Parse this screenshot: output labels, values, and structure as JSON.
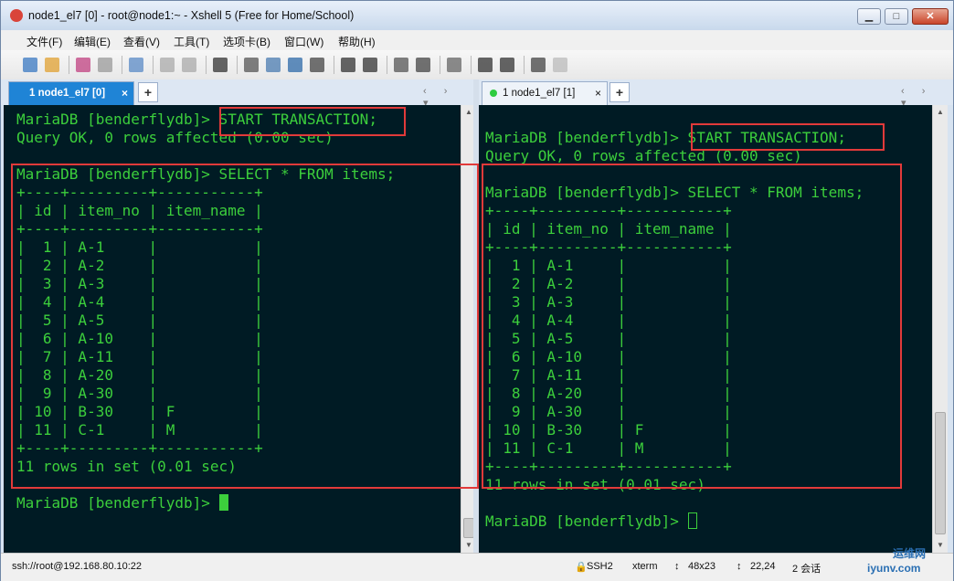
{
  "window": {
    "title": "node1_el7 [0] - root@node1:~ - Xshell 5 (Free for Home/School)",
    "buttons": {
      "minimize": "▁",
      "maximize": "□",
      "close": "✕"
    }
  },
  "menu": [
    "文件(F)",
    "编辑(E)",
    "查看(V)",
    "工具(T)",
    "选项卡(B)",
    "窗口(W)",
    "帮助(H)"
  ],
  "toolbar": {
    "icons": [
      "new-session-icon",
      "open-folder-icon",
      "reconnect-icon",
      "disconnect-icon",
      "properties-icon",
      "copy-icon",
      "paste-icon",
      "find-icon",
      "print-icon",
      "transfer-icon",
      "globe-icon",
      "font-icon",
      "xftp-icon",
      "xmanager-icon",
      "fullscreen-icon",
      "lock-icon",
      "keyboard-icon",
      "add-icon",
      "layout-icon",
      "help-icon",
      "chat-icon"
    ]
  },
  "left_pane": {
    "tab_label": "1 node1_el7 [0]",
    "tab_close": "×",
    "tab_add": "+",
    "lines": [
      "MariaDB [benderflydb]> START TRANSACTION;",
      "Query OK, 0 rows affected (0.00 sec)",
      "",
      "MariaDB [benderflydb]> SELECT * FROM items;",
      "+----+---------+-----------+",
      "| id | item_no | item_name |",
      "+----+---------+-----------+",
      "|  1 | A-1     |           |",
      "|  2 | A-2     |           |",
      "|  3 | A-3     |           |",
      "|  4 | A-4     |           |",
      "|  5 | A-5     |           |",
      "|  6 | A-10    |           |",
      "|  7 | A-11    |           |",
      "|  8 | A-20    |           |",
      "|  9 | A-30    |           |",
      "| 10 | B-30    | F         |",
      "| 11 | C-1     | M         |",
      "+----+---------+-----------+",
      "11 rows in set (0.01 sec)",
      "",
      "MariaDB [benderflydb]> "
    ]
  },
  "right_pane": {
    "tab_label": "1 node1_el7 [1]",
    "tab_close": "×",
    "tab_add": "+",
    "lines": [
      "",
      "MariaDB [benderflydb]> START TRANSACTION;",
      "Query OK, 0 rows affected (0.00 sec)",
      "",
      "MariaDB [benderflydb]> SELECT * FROM items;",
      "+----+---------+-----------+",
      "| id | item_no | item_name |",
      "+----+---------+-----------+",
      "|  1 | A-1     |           |",
      "|  2 | A-2     |           |",
      "|  3 | A-3     |           |",
      "|  4 | A-4     |           |",
      "|  5 | A-5     |           |",
      "|  6 | A-10    |           |",
      "|  7 | A-11    |           |",
      "|  8 | A-20    |           |",
      "|  9 | A-30    |           |",
      "| 10 | B-30    | F         |",
      "| 11 | C-1     | M         |",
      "+----+---------+-----------+",
      "11 rows in set (0.01 sec)",
      "",
      "MariaDB [benderflydb]> "
    ]
  },
  "status": {
    "connection": "ssh://root@192.168.80.10:22",
    "protocol": "SSH2",
    "terminal": "xterm",
    "size": "48x23",
    "cursor_pos": "22,24",
    "sessions": "2 会话"
  },
  "watermark": {
    "text_top": "运维网",
    "text_bottom": "iyunv.com"
  },
  "colors": {
    "terminal_bg": "#001b24",
    "terminal_fg": "#3ccf3c",
    "highlight": "#e23a3a",
    "active_tab": "#1f84d6"
  }
}
